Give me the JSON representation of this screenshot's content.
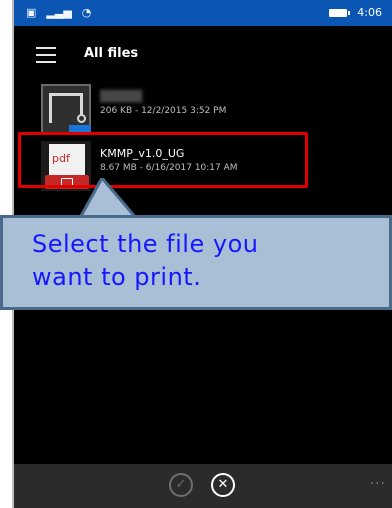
{
  "status_bar": {
    "left_icons": [
      "sim-icon",
      "signal-icon",
      "wifi-icon"
    ],
    "time": "4:06"
  },
  "header": {
    "title": "All files"
  },
  "files": [
    {
      "name": "",
      "meta": "206 KB - 12/2/2015 3:52 PM",
      "icon": "document-icon"
    },
    {
      "name": "KMMP_v1.0_UG",
      "meta": "8.67 MB - 6/16/2017 10:17 AM",
      "icon": "pdf-icon",
      "pdf_label": "pdf"
    }
  ],
  "callout": {
    "text_line1": "Select the file you",
    "text_line2": "want to print."
  },
  "app_bar": {
    "more": "···"
  },
  "colors": {
    "status_bar": "#0b56b3",
    "highlight": "#e00000",
    "callout_bg": "#a9bfd6",
    "callout_text": "#1717ff",
    "pdf_red": "#c62828"
  }
}
